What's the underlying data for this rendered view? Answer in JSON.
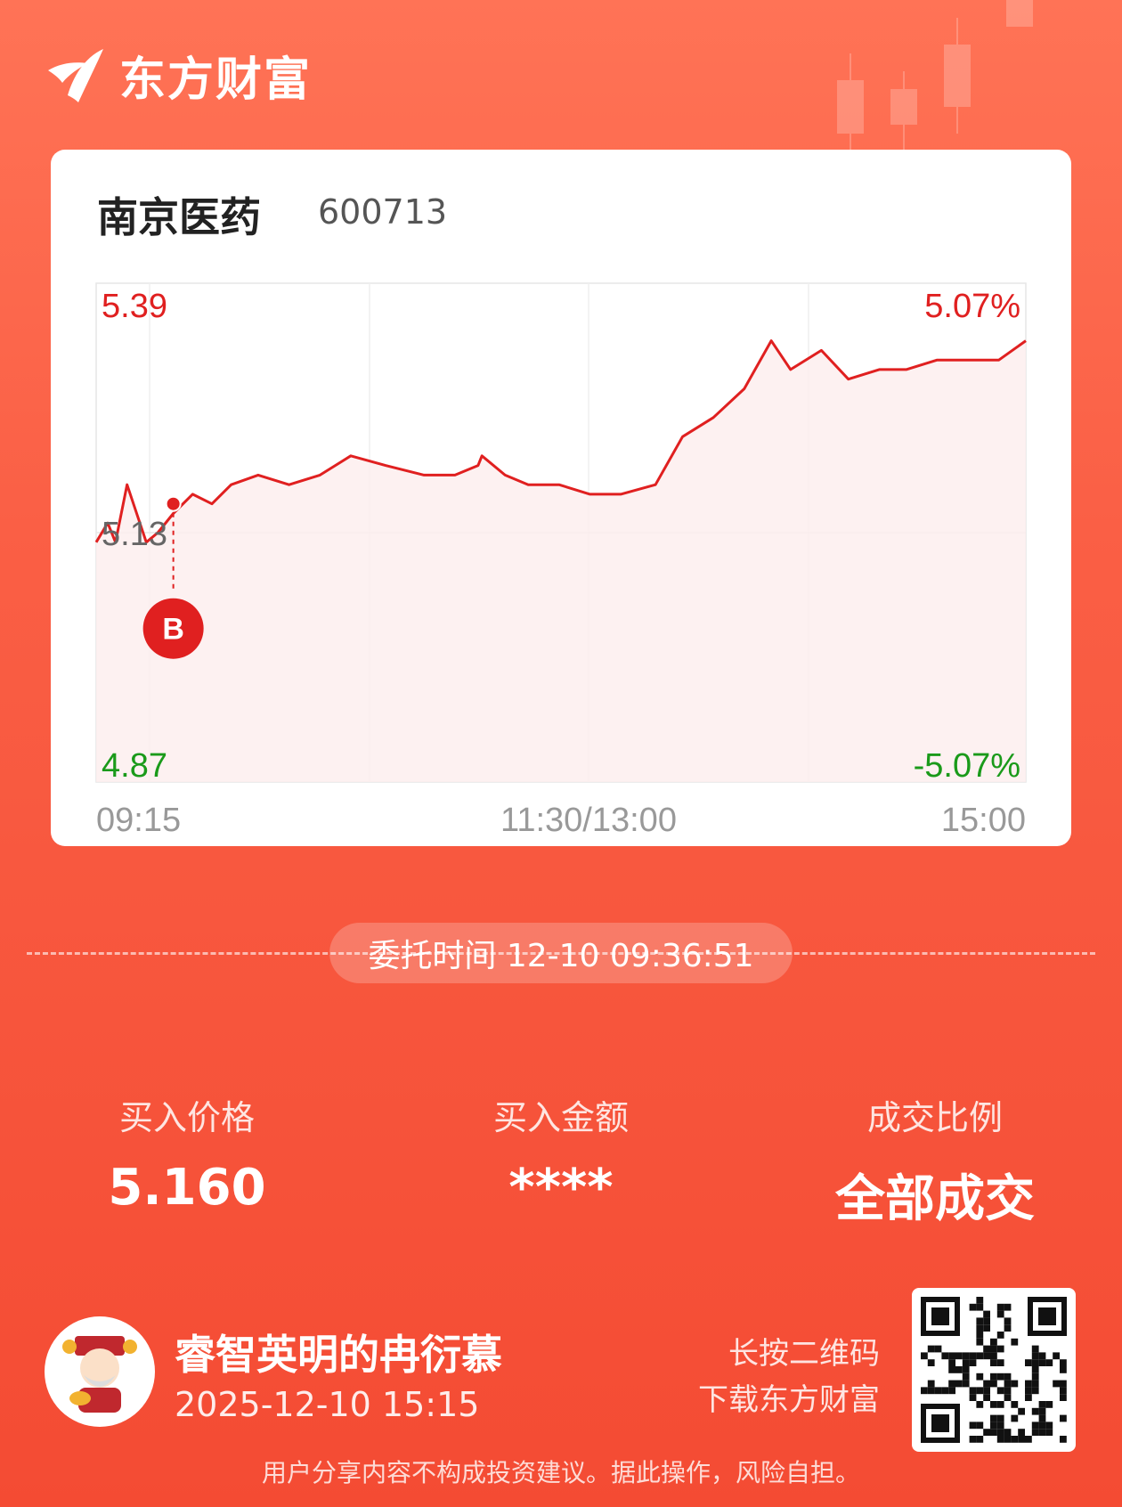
{
  "brand": {
    "name": "东方财富",
    "logo_icon": "eastmoney-logo"
  },
  "stock": {
    "name": "南京医药",
    "code": "600713"
  },
  "chart_data": {
    "type": "line",
    "title": "",
    "x_labels": [
      "09:15",
      "11:30/13:00",
      "15:00"
    ],
    "y_left": {
      "top": "5.39",
      "mid": "5.13",
      "bottom": "4.87"
    },
    "y_right": {
      "top": "5.07%",
      "bottom": "-5.07%"
    },
    "ylim": [
      4.87,
      5.39
    ],
    "reference_price": 5.13,
    "grid": true,
    "series": [
      {
        "x": [
          0,
          3,
          5,
          8,
          13,
          16,
          20,
          25,
          30,
          35,
          42,
          50,
          58,
          66,
          75,
          85,
          93,
          99,
          100,
          106,
          112,
          120,
          128,
          136,
          145,
          152,
          160,
          168,
          175,
          180,
          188,
          195,
          203,
          210,
          218,
          226,
          234,
          241
        ],
        "y": [
          5.12,
          5.14,
          5.12,
          5.18,
          5.12,
          5.13,
          5.15,
          5.17,
          5.16,
          5.18,
          5.19,
          5.18,
          5.19,
          5.21,
          5.2,
          5.19,
          5.19,
          5.2,
          5.21,
          5.19,
          5.18,
          5.18,
          5.17,
          5.17,
          5.18,
          5.23,
          5.25,
          5.28,
          5.33,
          5.3,
          5.32,
          5.29,
          5.3,
          5.3,
          5.31,
          5.31,
          5.31,
          5.33
        ],
        "color": "#e02020"
      }
    ],
    "buy_marker": {
      "x": 20,
      "y": 5.16,
      "label": "B"
    }
  },
  "order_time": "委托时间 12-10 09:36:51",
  "stats": [
    {
      "label": "买入价格",
      "value": "5.160"
    },
    {
      "label": "买入金额",
      "value": "****"
    },
    {
      "label": "成交比例",
      "value": "全部成交"
    }
  ],
  "user": {
    "name": "睿智英明的冉衍慕",
    "time": "2025-12-10 15:15",
    "avatar_icon": "fortune-god-avatar"
  },
  "qr": {
    "hint_line1": "长按二维码",
    "hint_line2": "下载东方财富",
    "icon": "qr-code"
  },
  "disclaimer": "用户分享内容不构成投资建议。据此操作，风险自担。",
  "colors": {
    "up": "#e02020",
    "down": "#1a9a1a",
    "accent": "#f44b33"
  }
}
